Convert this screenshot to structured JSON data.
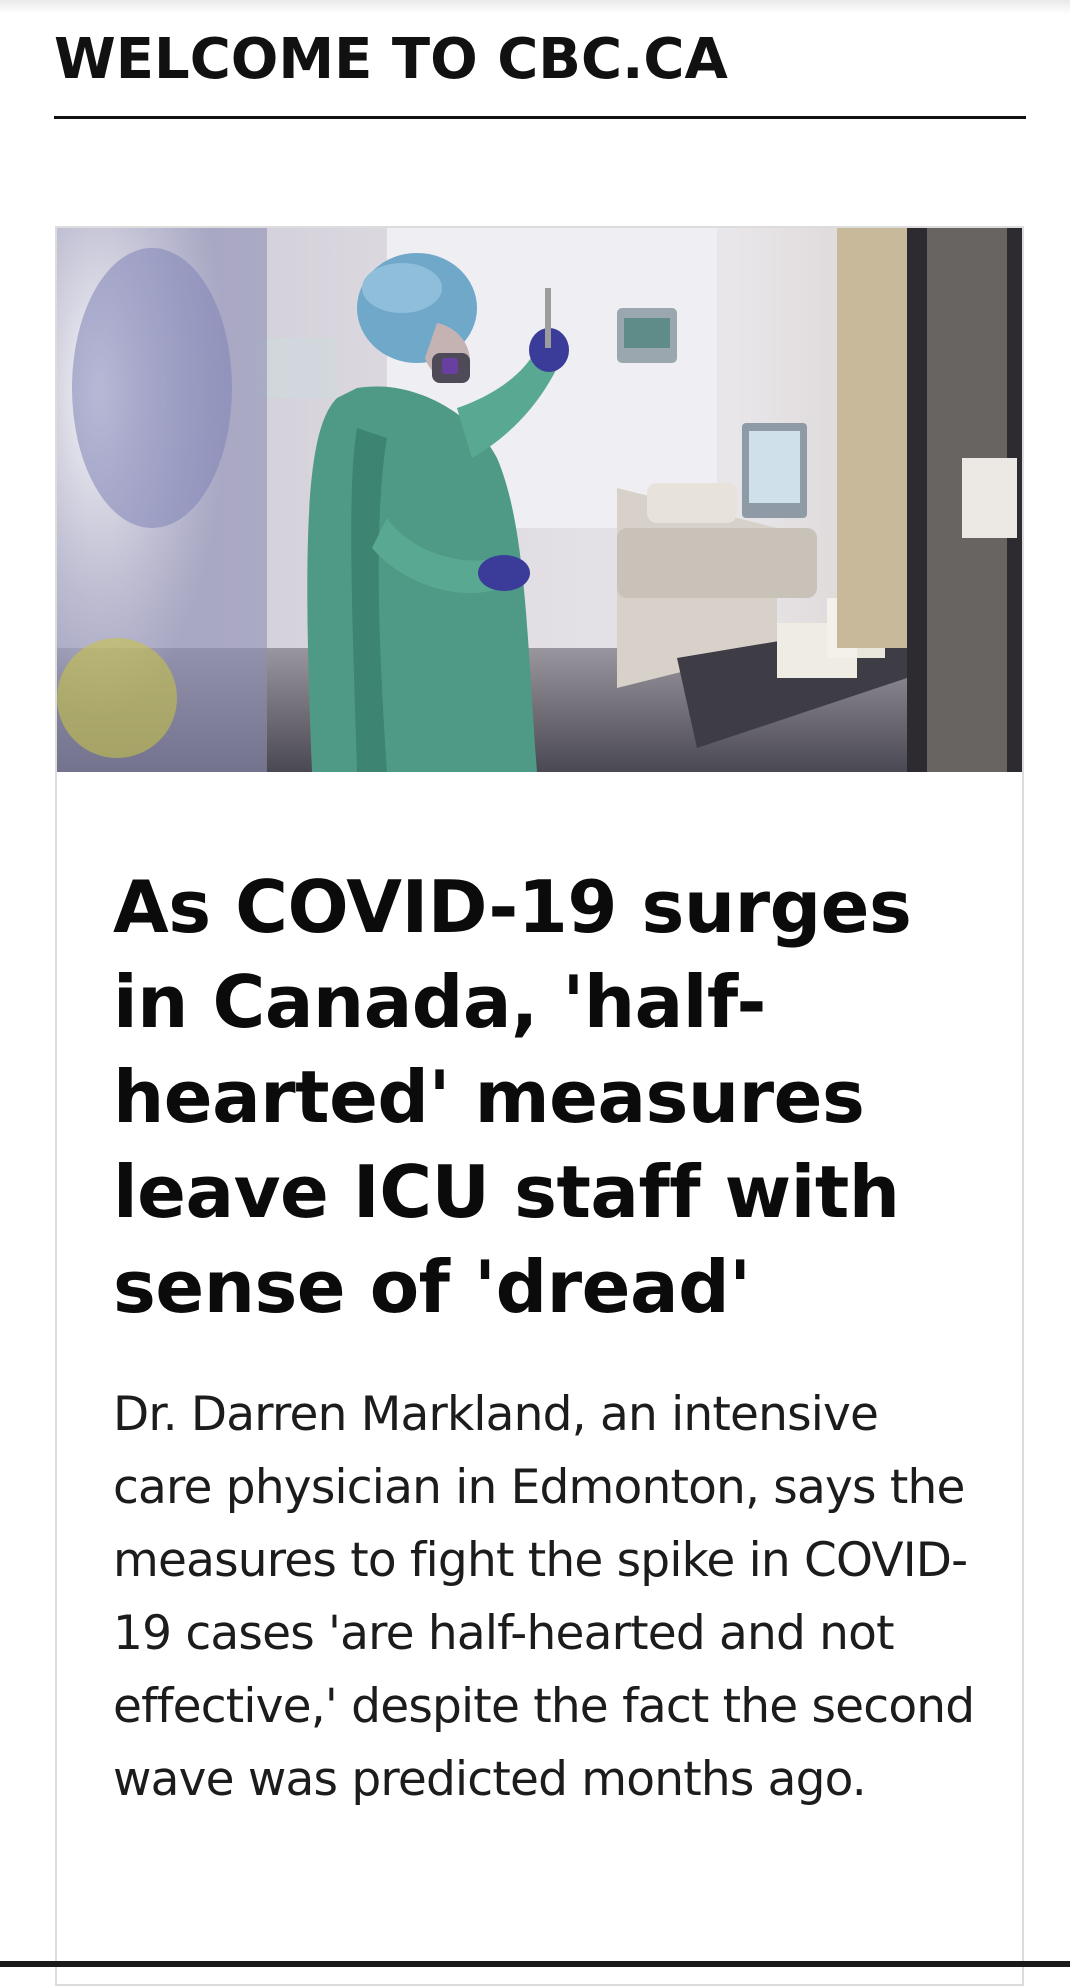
{
  "header": {
    "site_title": "WELCOME TO CBC.CA"
  },
  "story": {
    "image_alt": "ICU health-care worker in protective gear",
    "headline": "As COVID-19 surges in Canada, 'half-hearted' measures leave ICU staff with sense of 'dread'",
    "summary": "Dr. Darren Markland, an intensive care physician in Edmonton, says the measures to fight the spike in COVID-19 cases 'are half-hearted and not effective,' despite the fact the second wave was predicted months ago."
  },
  "colors": {
    "text": "#111111",
    "card_border": "#dcdcdc",
    "gown": "#4f9a86",
    "cap": "#6fa8c9",
    "gloves": "#3b3b9a"
  }
}
